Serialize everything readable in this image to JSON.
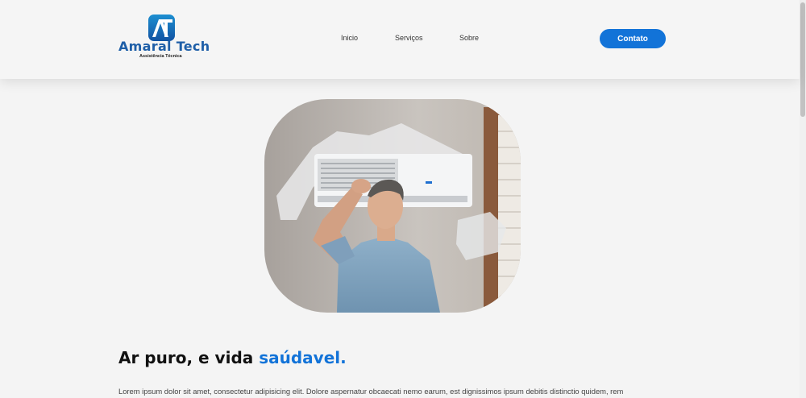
{
  "brand": {
    "monogram": "AT",
    "name": "Amaral Tech",
    "tagline": "Assistência Técnica"
  },
  "nav": {
    "items": [
      {
        "label": "Inicio"
      },
      {
        "label": "Serviços"
      },
      {
        "label": "Sobre"
      }
    ],
    "cta_label": "Contato"
  },
  "hero": {
    "image_alt": "man-cooling-under-air-conditioner"
  },
  "section": {
    "headline_part1": "Ar puro, e vida ",
    "headline_accent": "saúdavel.",
    "paragraph": "Lorem ipsum dolor sit amet, consectetur adipisicing elit. Dolore aspernatur obcaecati nemo earum, est dignissimos ipsum debitis distinctio quidem, rem"
  },
  "colors": {
    "accent": "#1273d8",
    "header_bg": "#f5f5f5",
    "page_bg": "#f4f4f4"
  }
}
